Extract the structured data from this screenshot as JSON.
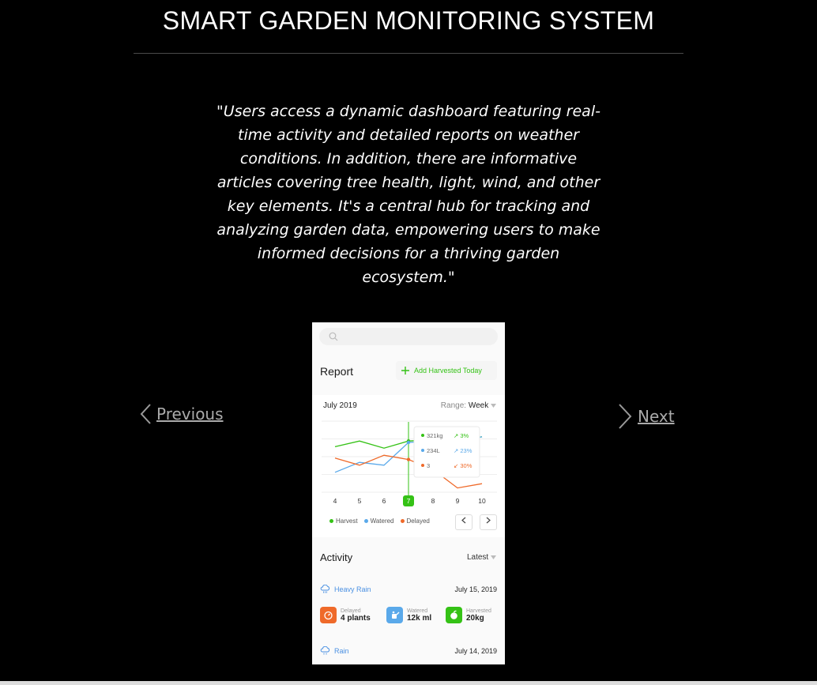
{
  "header": {
    "title": "SMART GARDEN MONITORING SYSTEM"
  },
  "quote": "\"Users access a dynamic dashboard featuring real-time activity and detailed reports on weather conditions. In addition, there are informative articles covering tree health, light, wind, and other key elements. It's a central hub for tracking and analyzing garden data, empowering users to make informed decisions for a thriving garden ecosystem.\"",
  "nav": {
    "previous": "Previous",
    "next": "Next"
  },
  "phone": {
    "report_title": "Report",
    "add_button": "Add Harvested Today",
    "month": "July 2019",
    "range_label": "Range:",
    "range_value": "Week",
    "tooltip": [
      {
        "value": "321kg",
        "change": "3%",
        "direction": "up"
      },
      {
        "value": "234L",
        "change": "23%",
        "direction": "up"
      },
      {
        "value": "3",
        "change": "30%",
        "direction": "down"
      }
    ],
    "legend": [
      "Harvest",
      "Watered",
      "Delayed"
    ],
    "activity_title": "Activity",
    "latest_label": "Latest",
    "entries": [
      {
        "weather": "Heavy Rain",
        "date": "July 15, 2019"
      },
      {
        "weather": "Rain",
        "date": "July 14, 2019"
      }
    ],
    "stats": [
      {
        "label": "Delayed",
        "value": "4 plants"
      },
      {
        "label": "Watered",
        "value": "12k ml"
      },
      {
        "label": "Harvested",
        "value": "20kg"
      }
    ]
  },
  "colors": {
    "harvest": "#35c216",
    "watered": "#5aa9ea",
    "delayed": "#ef6a2a"
  },
  "chart_data": {
    "type": "line",
    "x": [
      4,
      5,
      6,
      7,
      8,
      9,
      10
    ],
    "selected_x": 7,
    "ylim": [
      0,
      5
    ],
    "series": [
      {
        "name": "Harvest",
        "values": [
          3.2,
          3.6,
          3.1,
          3.6,
          3.7,
          3.6,
          3.9
        ]
      },
      {
        "name": "Watered",
        "values": [
          1.4,
          2.1,
          1.9,
          3.5,
          3.6,
          3.4,
          3.9
        ]
      },
      {
        "name": "Delayed",
        "values": [
          2.4,
          1.9,
          2.6,
          2.3,
          1.6,
          0.3,
          0.6
        ]
      }
    ]
  }
}
